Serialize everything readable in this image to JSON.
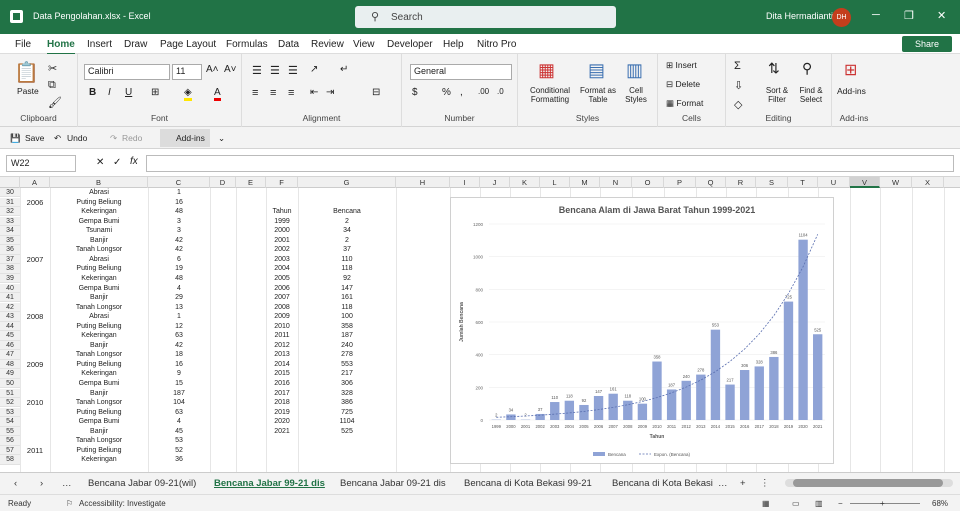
{
  "window": {
    "file_title": "Data Pengolahan.xlsx  -  Excel",
    "search_placeholder": "Search",
    "user_name": "Dita Hermadianti",
    "user_initials": "DH"
  },
  "menu": [
    "File",
    "Home",
    "Insert",
    "Draw",
    "Page Layout",
    "Formulas",
    "Data",
    "Review",
    "View",
    "Developer",
    "Help",
    "Nitro Pro"
  ],
  "share_label": "Share",
  "ribbon": {
    "clipboard": {
      "paste": "Paste",
      "label": "Clipboard"
    },
    "font": {
      "name": "Calibri",
      "size": "11",
      "label": "Font"
    },
    "alignment": {
      "label": "Alignment"
    },
    "number": {
      "format": "General",
      "label": "Number"
    },
    "styles": {
      "conditional": "Conditional Formatting",
      "format_table": "Format as Table",
      "cell_styles": "Cell Styles",
      "label": "Styles"
    },
    "cells": {
      "insert": "Insert",
      "delete": "Delete",
      "format": "Format",
      "label": "Cells"
    },
    "editing": {
      "sort": "Sort & Filter",
      "find": "Find & Select",
      "label": "Editing"
    },
    "addins": {
      "btn": "Add-ins",
      "label": "Add-ins"
    }
  },
  "qat": {
    "save": "Save",
    "undo": "Undo",
    "redo": "Redo",
    "addins": "Add-ins"
  },
  "namebox": "W22",
  "columns": [
    "A",
    "B",
    "C",
    "D",
    "E",
    "F",
    "G",
    "H",
    "I",
    "J",
    "K",
    "L",
    "M",
    "N",
    "O",
    "P",
    "Q",
    "R",
    "S",
    "T",
    "U",
    "V",
    "W",
    "X"
  ],
  "rows": [
    {
      "n": "30",
      "a": "",
      "b": "Abrasi",
      "c": "1",
      "f": "",
      "g": ""
    },
    {
      "n": "31",
      "a": "2006",
      "b": "Puting Beliung",
      "c": "16",
      "f": "",
      "g": ""
    },
    {
      "n": "32",
      "a": "",
      "b": "Kekeringan",
      "c": "48",
      "f": "Tahun",
      "g": "Bencana"
    },
    {
      "n": "33",
      "a": "",
      "b": "Gempa Bumi",
      "c": "3",
      "f": "1999",
      "g": "2"
    },
    {
      "n": "34",
      "a": "",
      "b": "Tsunami",
      "c": "3",
      "f": "2000",
      "g": "34"
    },
    {
      "n": "35",
      "a": "",
      "b": "Banjir",
      "c": "42",
      "f": "2001",
      "g": "2"
    },
    {
      "n": "36",
      "a": "",
      "b": "Tanah Longsor",
      "c": "42",
      "f": "2002",
      "g": "37"
    },
    {
      "n": "37",
      "a": "2007",
      "b": "Abrasi",
      "c": "6",
      "f": "2003",
      "g": "110"
    },
    {
      "n": "38",
      "a": "",
      "b": "Puting Beliung",
      "c": "19",
      "f": "2004",
      "g": "118"
    },
    {
      "n": "39",
      "a": "",
      "b": "Kekeringan",
      "c": "48",
      "f": "2005",
      "g": "92"
    },
    {
      "n": "40",
      "a": "",
      "b": "Gempa Bumi",
      "c": "4",
      "f": "2006",
      "g": "147"
    },
    {
      "n": "41",
      "a": "",
      "b": "Banjir",
      "c": "29",
      "f": "2007",
      "g": "161"
    },
    {
      "n": "42",
      "a": "",
      "b": "Tanah Longsor",
      "c": "13",
      "f": "2008",
      "g": "118"
    },
    {
      "n": "43",
      "a": "2008",
      "b": "Abrasi",
      "c": "1",
      "f": "2009",
      "g": "100"
    },
    {
      "n": "44",
      "a": "",
      "b": "Puting Beliung",
      "c": "12",
      "f": "2010",
      "g": "358"
    },
    {
      "n": "45",
      "a": "",
      "b": "Kekeringan",
      "c": "63",
      "f": "2011",
      "g": "187"
    },
    {
      "n": "46",
      "a": "",
      "b": "Banjir",
      "c": "42",
      "f": "2012",
      "g": "240"
    },
    {
      "n": "47",
      "a": "",
      "b": "Tanah Longsor",
      "c": "18",
      "f": "2013",
      "g": "278"
    },
    {
      "n": "48",
      "a": "2009",
      "b": "Puting Beliung",
      "c": "16",
      "f": "2014",
      "g": "553"
    },
    {
      "n": "49",
      "a": "",
      "b": "Kekeringan",
      "c": "9",
      "f": "2015",
      "g": "217"
    },
    {
      "n": "50",
      "a": "",
      "b": "Gempa Bumi",
      "c": "15",
      "f": "2016",
      "g": "306"
    },
    {
      "n": "51",
      "a": "",
      "b": "Banjir",
      "c": "187",
      "f": "2017",
      "g": "328"
    },
    {
      "n": "52",
      "a": "2010",
      "b": "Tanah Longsor",
      "c": "104",
      "f": "2018",
      "g": "386"
    },
    {
      "n": "53",
      "a": "",
      "b": "Puting Beliung",
      "c": "63",
      "f": "2019",
      "g": "725"
    },
    {
      "n": "54",
      "a": "",
      "b": "Gempa Bumi",
      "c": "4",
      "f": "2020",
      "g": "1104"
    },
    {
      "n": "55",
      "a": "",
      "b": "Banjir",
      "c": "45",
      "f": "2021",
      "g": "525"
    },
    {
      "n": "56",
      "a": "",
      "b": "Tanah Longsor",
      "c": "53",
      "f": "",
      "g": ""
    },
    {
      "n": "57",
      "a": "2011",
      "b": "Puting Beliung",
      "c": "52",
      "f": "",
      "g": ""
    },
    {
      "n": "58",
      "a": "",
      "b": "Kekeringan",
      "c": "36",
      "f": "",
      "g": ""
    }
  ],
  "chart_data": {
    "type": "bar",
    "title": "Bencana Alam di Jawa Barat Tahun 1999-2021",
    "xlabel": "Tahun",
    "ylabel": "Jumlah Bencana",
    "ylim": [
      0,
      1200
    ],
    "yticks": [
      "0",
      "200",
      "400",
      "600",
      "800",
      "1000",
      "1200"
    ],
    "categories": [
      "1999",
      "2000",
      "2001",
      "2002",
      "2003",
      "2004",
      "2005",
      "2006",
      "2007",
      "2008",
      "2009",
      "2010",
      "2011",
      "2012",
      "2013",
      "2014",
      "2015",
      "2016",
      "2017",
      "2018",
      "2019",
      "2020",
      "2021"
    ],
    "series": [
      {
        "name": "Bencana",
        "values": [
          2,
          34,
          2,
          37,
          110,
          118,
          92,
          147,
          161,
          118,
          100,
          358,
          187,
          240,
          278,
          553,
          217,
          306,
          328,
          386,
          725,
          1104,
          525
        ]
      }
    ],
    "trendline": "Expon. (Bencana)",
    "bar_color": "#8fa3d6",
    "legend": "bottom"
  },
  "sheet_tabs": [
    "Bencana Jabar 09-21(wil)",
    "Bencana Jabar 99-21 dis",
    "Bencana Jabar 09-21 dis",
    "Bencana di Kota Bekasi 99-21",
    "Bencana di Kota Bekasi"
  ],
  "active_tab": 1,
  "status": {
    "ready": "Ready",
    "accessibility": "Accessibility: Investigate",
    "zoom": "68%"
  }
}
